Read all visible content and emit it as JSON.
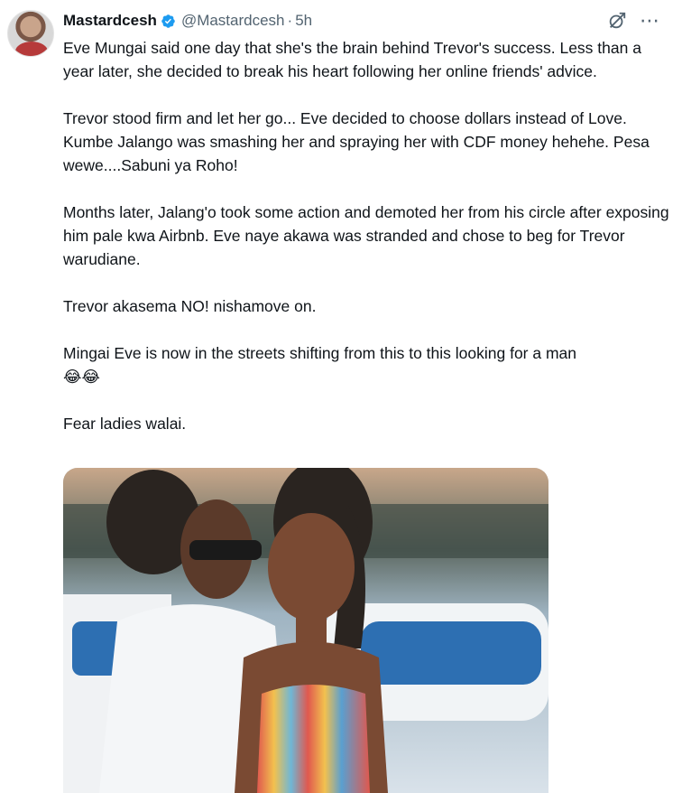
{
  "tweet": {
    "display_name": "Mastardcesh",
    "handle": "@Mastardcesh",
    "separator": "·",
    "time": "5h",
    "paragraphs": [
      "Eve Mungai said one day that she's the brain behind Trevor's success. Less than a year later, she decided to break his heart following her online friends' advice.",
      "Trevor stood firm and let her go... Eve decided to choose dollars instead of Love. Kumbe Jalango was smashing her and spraying her with CDF money hehehe. Pesa wewe....Sabuni ya Roho!",
      "Months later, Jalang'o took some action and demoted her from his circle after exposing him pale kwa Airbnb. Eve naye akawa was stranded and chose to beg for Trevor warudiane.",
      "Trevor akasema NO! nishamove on.",
      "Mingai Eve is now in the streets shifting from this to this looking for a man\n😂😂",
      "Fear ladies walai."
    ],
    "icons": {
      "verified": "verified-badge-icon",
      "grok": "grok-icon",
      "more": "more-options-icon"
    },
    "colors": {
      "verified": "#1d9bf0",
      "secondary_text": "#536471"
    }
  }
}
